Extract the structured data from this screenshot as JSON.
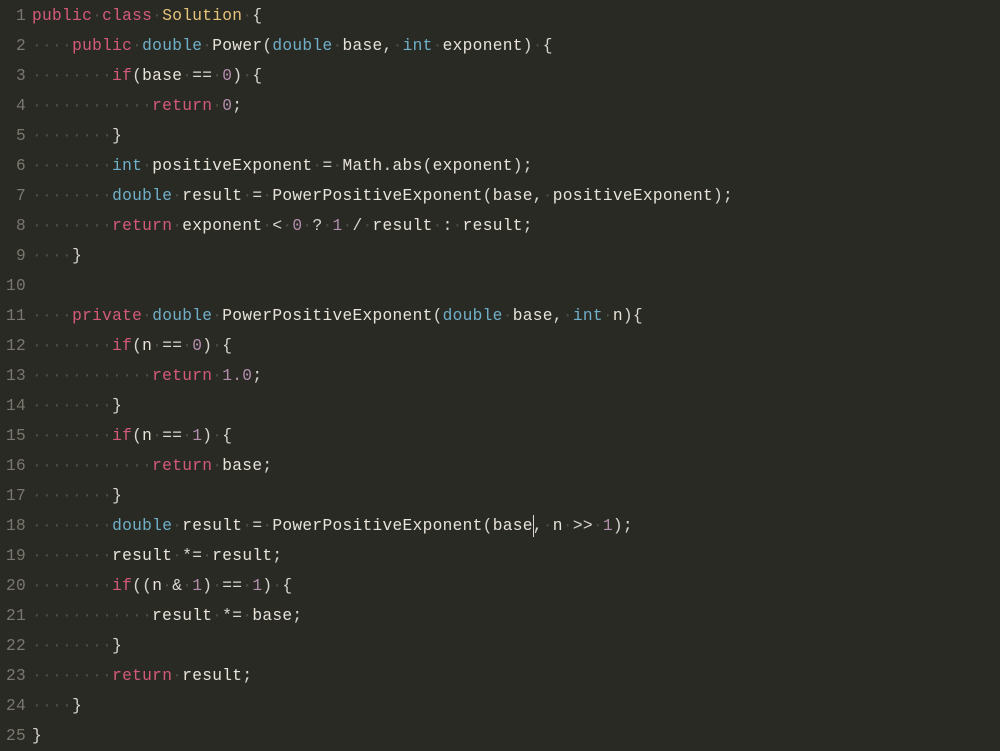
{
  "editor": {
    "lineCount": 25,
    "cursor": {
      "line": 18,
      "afterText": "        double result = PowerPositiveExponent(base"
    },
    "lines": [
      {
        "n": 1,
        "indent": 0,
        "tokens": [
          [
            "kw",
            "public"
          ],
          [
            "sp",
            " "
          ],
          [
            "kw",
            "class"
          ],
          [
            "sp",
            " "
          ],
          [
            "cls",
            "Solution"
          ],
          [
            "sp",
            " "
          ],
          [
            "punct",
            "{"
          ]
        ]
      },
      {
        "n": 2,
        "indent": 4,
        "tokens": [
          [
            "kw",
            "public"
          ],
          [
            "sp",
            " "
          ],
          [
            "type",
            "double"
          ],
          [
            "sp",
            " "
          ],
          [
            "fn",
            "Power"
          ],
          [
            "punct",
            "("
          ],
          [
            "type",
            "double"
          ],
          [
            "sp",
            " "
          ],
          [
            "fn",
            "base"
          ],
          [
            "punct",
            ","
          ],
          [
            "sp",
            " "
          ],
          [
            "type",
            "int"
          ],
          [
            "sp",
            " "
          ],
          [
            "fn",
            "exponent"
          ],
          [
            "punct",
            ")"
          ],
          [
            "sp",
            " "
          ],
          [
            "punct",
            "{"
          ]
        ]
      },
      {
        "n": 3,
        "indent": 8,
        "tokens": [
          [
            "kw",
            "if"
          ],
          [
            "punct",
            "("
          ],
          [
            "fn",
            "base"
          ],
          [
            "sp",
            " "
          ],
          [
            "op",
            "=="
          ],
          [
            "sp",
            " "
          ],
          [
            "num",
            "0"
          ],
          [
            "punct",
            ")"
          ],
          [
            "sp",
            " "
          ],
          [
            "punct",
            "{"
          ]
        ]
      },
      {
        "n": 4,
        "indent": 12,
        "tokens": [
          [
            "kw",
            "return"
          ],
          [
            "sp",
            " "
          ],
          [
            "num",
            "0"
          ],
          [
            "punct",
            ";"
          ]
        ]
      },
      {
        "n": 5,
        "indent": 8,
        "tokens": [
          [
            "punct",
            "}"
          ]
        ]
      },
      {
        "n": 6,
        "indent": 8,
        "tokens": [
          [
            "type",
            "int"
          ],
          [
            "sp",
            " "
          ],
          [
            "fn",
            "positiveExponent"
          ],
          [
            "sp",
            " "
          ],
          [
            "op",
            "="
          ],
          [
            "sp",
            " "
          ],
          [
            "fn",
            "Math"
          ],
          [
            "punct",
            "."
          ],
          [
            "fn",
            "abs"
          ],
          [
            "punct",
            "("
          ],
          [
            "fn",
            "exponent"
          ],
          [
            "punct",
            ")"
          ],
          [
            "punct",
            ";"
          ]
        ]
      },
      {
        "n": 7,
        "indent": 8,
        "tokens": [
          [
            "type",
            "double"
          ],
          [
            "sp",
            " "
          ],
          [
            "fn",
            "result"
          ],
          [
            "sp",
            " "
          ],
          [
            "op",
            "="
          ],
          [
            "sp",
            " "
          ],
          [
            "fn",
            "PowerPositiveExponent"
          ],
          [
            "punct",
            "("
          ],
          [
            "fn",
            "base"
          ],
          [
            "punct",
            ","
          ],
          [
            "sp",
            " "
          ],
          [
            "fn",
            "positiveExponent"
          ],
          [
            "punct",
            ")"
          ],
          [
            "punct",
            ";"
          ]
        ]
      },
      {
        "n": 8,
        "indent": 8,
        "tokens": [
          [
            "kw",
            "return"
          ],
          [
            "sp",
            " "
          ],
          [
            "fn",
            "exponent"
          ],
          [
            "sp",
            " "
          ],
          [
            "op",
            "<"
          ],
          [
            "sp",
            " "
          ],
          [
            "num",
            "0"
          ],
          [
            "sp",
            " "
          ],
          [
            "op",
            "?"
          ],
          [
            "sp",
            " "
          ],
          [
            "num",
            "1"
          ],
          [
            "sp",
            " "
          ],
          [
            "op",
            "/"
          ],
          [
            "sp",
            " "
          ],
          [
            "fn",
            "result"
          ],
          [
            "sp",
            " "
          ],
          [
            "op",
            ":"
          ],
          [
            "sp",
            " "
          ],
          [
            "fn",
            "result"
          ],
          [
            "punct",
            ";"
          ]
        ]
      },
      {
        "n": 9,
        "indent": 4,
        "tokens": [
          [
            "punct",
            "}"
          ]
        ]
      },
      {
        "n": 10,
        "indent": 0,
        "tokens": []
      },
      {
        "n": 11,
        "indent": 4,
        "tokens": [
          [
            "kw",
            "private"
          ],
          [
            "sp",
            " "
          ],
          [
            "type",
            "double"
          ],
          [
            "sp",
            " "
          ],
          [
            "fn",
            "PowerPositiveExponent"
          ],
          [
            "punct",
            "("
          ],
          [
            "type",
            "double"
          ],
          [
            "sp",
            " "
          ],
          [
            "fn",
            "base"
          ],
          [
            "punct",
            ","
          ],
          [
            "sp",
            " "
          ],
          [
            "type",
            "int"
          ],
          [
            "sp",
            " "
          ],
          [
            "fn",
            "n"
          ],
          [
            "punct",
            ")"
          ],
          [
            "punct",
            "{"
          ]
        ]
      },
      {
        "n": 12,
        "indent": 8,
        "tokens": [
          [
            "kw",
            "if"
          ],
          [
            "punct",
            "("
          ],
          [
            "fn",
            "n"
          ],
          [
            "sp",
            " "
          ],
          [
            "op",
            "=="
          ],
          [
            "sp",
            " "
          ],
          [
            "num",
            "0"
          ],
          [
            "punct",
            ")"
          ],
          [
            "sp",
            " "
          ],
          [
            "punct",
            "{"
          ]
        ]
      },
      {
        "n": 13,
        "indent": 12,
        "tokens": [
          [
            "kw",
            "return"
          ],
          [
            "sp",
            " "
          ],
          [
            "num",
            "1.0"
          ],
          [
            "punct",
            ";"
          ]
        ]
      },
      {
        "n": 14,
        "indent": 8,
        "tokens": [
          [
            "punct",
            "}"
          ]
        ]
      },
      {
        "n": 15,
        "indent": 8,
        "tokens": [
          [
            "kw",
            "if"
          ],
          [
            "punct",
            "("
          ],
          [
            "fn",
            "n"
          ],
          [
            "sp",
            " "
          ],
          [
            "op",
            "=="
          ],
          [
            "sp",
            " "
          ],
          [
            "num",
            "1"
          ],
          [
            "punct",
            ")"
          ],
          [
            "sp",
            " "
          ],
          [
            "punct",
            "{"
          ]
        ]
      },
      {
        "n": 16,
        "indent": 12,
        "tokens": [
          [
            "kw",
            "return"
          ],
          [
            "sp",
            " "
          ],
          [
            "fn",
            "base"
          ],
          [
            "punct",
            ";"
          ]
        ]
      },
      {
        "n": 17,
        "indent": 8,
        "tokens": [
          [
            "punct",
            "}"
          ]
        ]
      },
      {
        "n": 18,
        "indent": 8,
        "tokens": [
          [
            "type",
            "double"
          ],
          [
            "sp",
            " "
          ],
          [
            "fn",
            "result"
          ],
          [
            "sp",
            " "
          ],
          [
            "op",
            "="
          ],
          [
            "sp",
            " "
          ],
          [
            "fn",
            "PowerPositiveExponent"
          ],
          [
            "punct",
            "("
          ],
          [
            "fn",
            "base"
          ],
          [
            "punct",
            ","
          ],
          [
            "sp",
            " "
          ],
          [
            "fn",
            "n"
          ],
          [
            "sp",
            " "
          ],
          [
            "op",
            ">>"
          ],
          [
            "sp",
            " "
          ],
          [
            "num",
            "1"
          ],
          [
            "punct",
            ")"
          ],
          [
            "punct",
            ";"
          ]
        ]
      },
      {
        "n": 19,
        "indent": 8,
        "tokens": [
          [
            "fn",
            "result"
          ],
          [
            "sp",
            " "
          ],
          [
            "op",
            "*="
          ],
          [
            "sp",
            " "
          ],
          [
            "fn",
            "result"
          ],
          [
            "punct",
            ";"
          ]
        ]
      },
      {
        "n": 20,
        "indent": 8,
        "tokens": [
          [
            "kw",
            "if"
          ],
          [
            "punct",
            "("
          ],
          [
            "punct",
            "("
          ],
          [
            "fn",
            "n"
          ],
          [
            "sp",
            " "
          ],
          [
            "op",
            "&"
          ],
          [
            "sp",
            " "
          ],
          [
            "num",
            "1"
          ],
          [
            "punct",
            ")"
          ],
          [
            "sp",
            " "
          ],
          [
            "op",
            "=="
          ],
          [
            "sp",
            " "
          ],
          [
            "num",
            "1"
          ],
          [
            "punct",
            ")"
          ],
          [
            "sp",
            " "
          ],
          [
            "punct",
            "{"
          ]
        ]
      },
      {
        "n": 21,
        "indent": 12,
        "tokens": [
          [
            "fn",
            "result"
          ],
          [
            "sp",
            " "
          ],
          [
            "op",
            "*="
          ],
          [
            "sp",
            " "
          ],
          [
            "fn",
            "base"
          ],
          [
            "punct",
            ";"
          ]
        ]
      },
      {
        "n": 22,
        "indent": 8,
        "tokens": [
          [
            "punct",
            "}"
          ]
        ]
      },
      {
        "n": 23,
        "indent": 8,
        "tokens": [
          [
            "kw",
            "return"
          ],
          [
            "sp",
            " "
          ],
          [
            "fn",
            "result"
          ],
          [
            "punct",
            ";"
          ]
        ]
      },
      {
        "n": 24,
        "indent": 4,
        "tokens": [
          [
            "punct",
            "}"
          ]
        ]
      },
      {
        "n": 25,
        "indent": 0,
        "tokens": [
          [
            "punct",
            "}"
          ]
        ]
      }
    ]
  }
}
